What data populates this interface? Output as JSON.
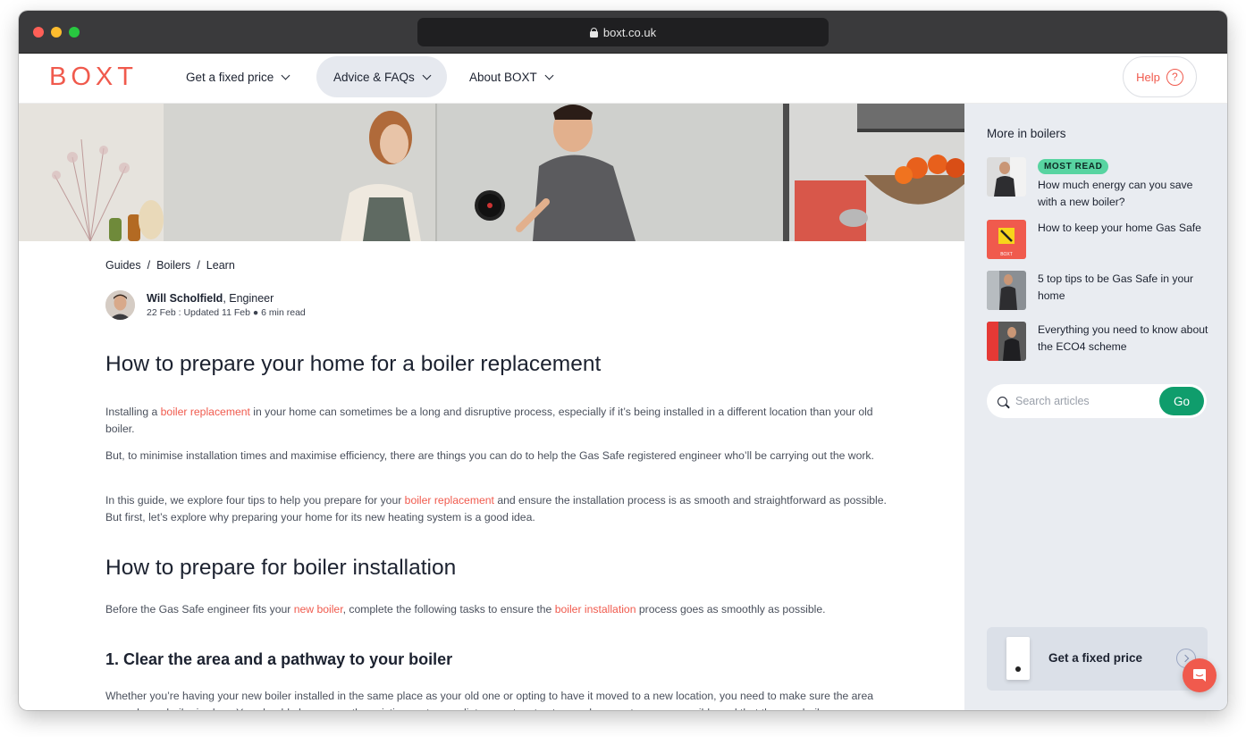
{
  "browser": {
    "url": "boxt.co.uk"
  },
  "nav": {
    "logo": "BOXT",
    "items": [
      {
        "label": "Get a fixed price"
      },
      {
        "label": "Advice & FAQs"
      },
      {
        "label": "About BOXT"
      }
    ],
    "help_label": "Help",
    "help_icon": "question-circle-icon"
  },
  "breadcrumb": [
    "Guides",
    "/",
    "Boilers",
    "/",
    "Learn"
  ],
  "author": {
    "name": "Will Scholfield",
    "role": ", Engineer",
    "meta": "22 Feb : Updated 11 Feb ● 6 min read"
  },
  "article": {
    "title": "How to prepare your home for a boiler replacement",
    "p1_a": "Installing a ",
    "p1_link": "boiler replacement",
    "p1_b": " in your home can sometimes be a long and disruptive process, especially if it’s being installed in a different location than your old boiler.",
    "p2": "But, to minimise installation times and maximise efficiency, there are things you can do to help the Gas Safe registered engineer who’ll be carrying out the work.",
    "p3_a": "In this guide, we explore four tips to help you prepare for your ",
    "p3_link": "boiler replacement",
    "p3_b": " and ensure the installation process is as smooth and straightforward as possible. But first, let’s explore why preparing your home for its new heating system is a good idea.",
    "h2": "How to prepare for boiler installation",
    "p4_a": "Before the Gas Safe engineer fits your ",
    "p4_link1": "new boiler",
    "p4_b": ", complete the following tasks to ensure the ",
    "p4_link2": "boiler installation",
    "p4_c": " process goes as smoothly as possible.",
    "h3": "1. Clear the area and a pathway to your boiler",
    "p5": "Whether you’re having your new boiler installed in the same place as your old one or opting to have it moved to a new location, you need to make sure the area around your boiler is clear. You should also ensure the existing system, radiators, water stop tap, and gas meter are accessible and that the new boiler"
  },
  "sidebar": {
    "title": "More in boilers",
    "items": [
      {
        "badge": "MOST READ",
        "text": "How much energy can you save with a new boiler?"
      },
      {
        "text": "How to keep your home Gas Safe",
        "thumb_label": "BOXT"
      },
      {
        "text": "5 top tips to be Gas Safe in your home"
      },
      {
        "text": "Everything you need to know about the ECO4 scheme"
      }
    ],
    "search_placeholder": "Search articles",
    "go_label": "Go",
    "price_card_label": "Get a fixed price"
  },
  "colors": {
    "brand": "#f05a4d",
    "go_green": "#0f9d6c",
    "badge_green": "#58d4a1",
    "sidebar_bg": "#e9ecf1"
  }
}
